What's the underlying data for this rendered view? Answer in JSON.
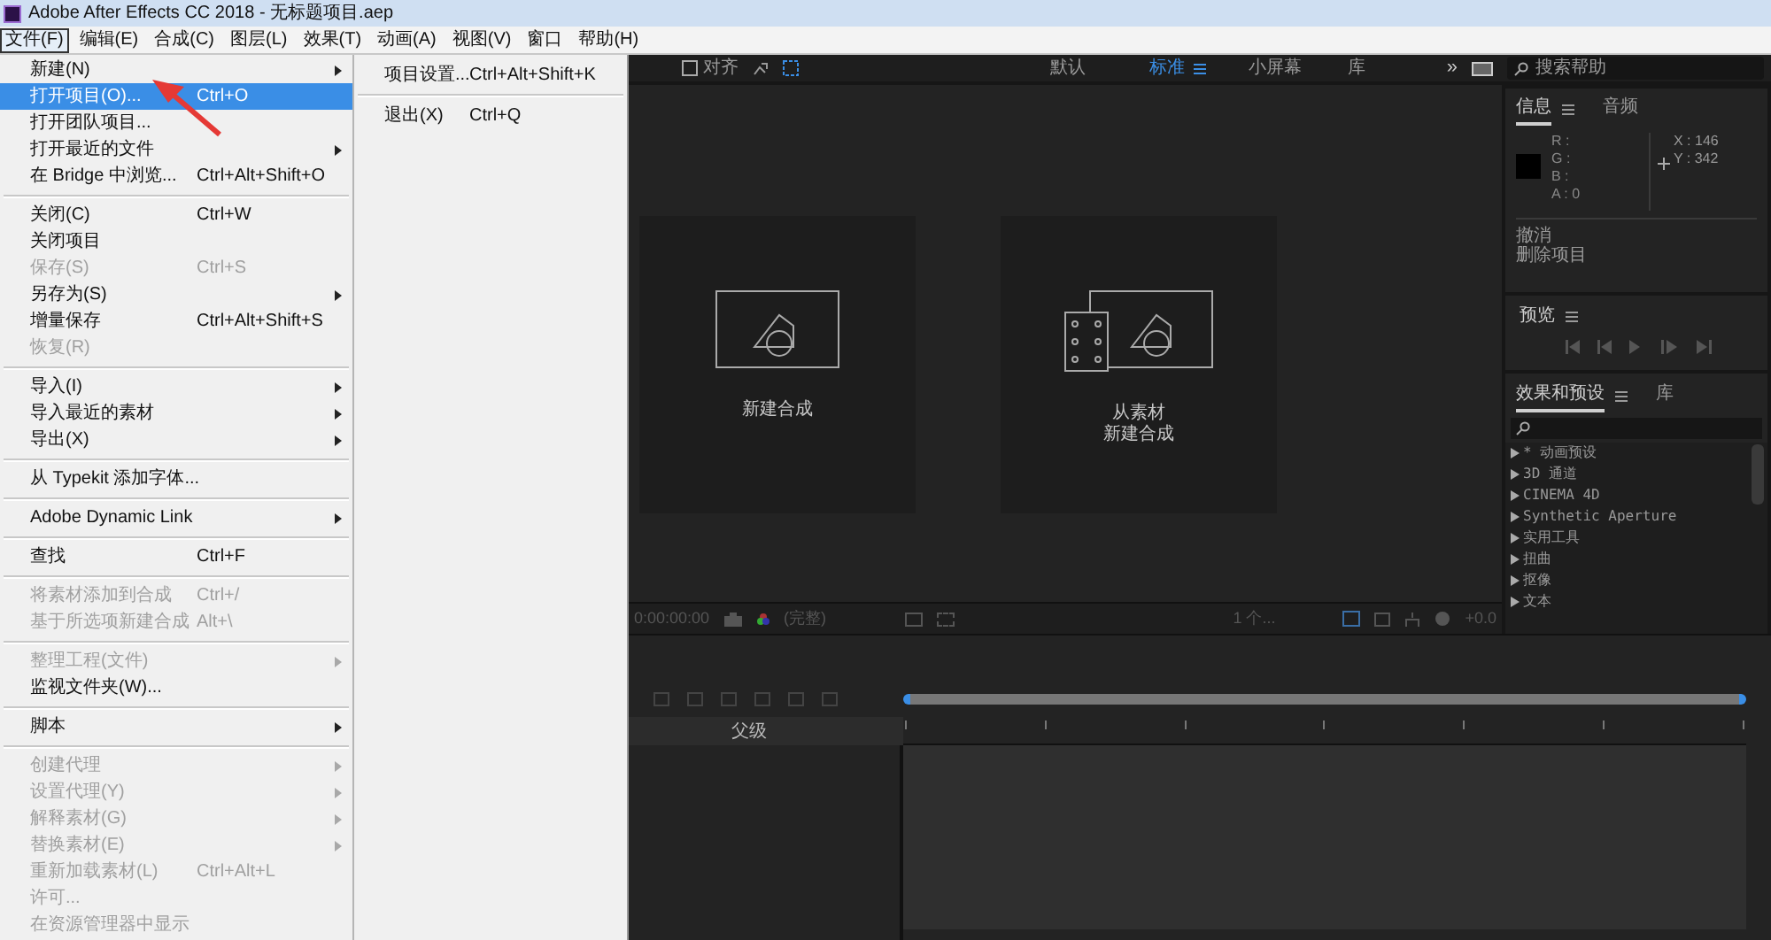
{
  "window": {
    "title": "Adobe After Effects CC 2018 - 无标题项目.aep"
  },
  "menubar": [
    {
      "label": "文件(F)",
      "selected": true
    },
    {
      "label": "编辑(E)",
      "selected": false
    },
    {
      "label": "合成(C)",
      "selected": false
    },
    {
      "label": "图层(L)",
      "selected": false
    },
    {
      "label": "效果(T)",
      "selected": false
    },
    {
      "label": "动画(A)",
      "selected": false
    },
    {
      "label": "视图(V)",
      "selected": false
    },
    {
      "label": "窗口",
      "selected": false
    },
    {
      "label": "帮助(H)",
      "selected": false
    }
  ],
  "file_menu": [
    [
      {
        "label": "新建(N)",
        "submenu": true,
        "disabled": false,
        "selected": false
      },
      {
        "label": "打开项目(O)...",
        "shortcut": "Ctrl+O",
        "disabled": false,
        "selected": true
      },
      {
        "label": "打开团队项目...",
        "disabled": false,
        "selected": false
      },
      {
        "label": "打开最近的文件",
        "submenu": true,
        "disabled": false,
        "selected": false
      },
      {
        "label": "在 Bridge 中浏览...",
        "shortcut": "Ctrl+Alt+Shift+O",
        "disabled": false,
        "selected": false
      }
    ],
    [
      {
        "label": "关闭(C)",
        "shortcut": "Ctrl+W",
        "disabled": false,
        "selected": false
      },
      {
        "label": "关闭项目",
        "disabled": false,
        "selected": false
      },
      {
        "label": "保存(S)",
        "shortcut": "Ctrl+S",
        "disabled": true,
        "selected": false
      },
      {
        "label": "另存为(S)",
        "submenu": true,
        "disabled": false,
        "selected": false
      },
      {
        "label": "增量保存",
        "shortcut": "Ctrl+Alt+Shift+S",
        "disabled": false,
        "selected": false
      },
      {
        "label": "恢复(R)",
        "disabled": true,
        "selected": false
      }
    ],
    [
      {
        "label": "导入(I)",
        "submenu": true,
        "disabled": false,
        "selected": false
      },
      {
        "label": "导入最近的素材",
        "submenu": true,
        "disabled": false,
        "selected": false
      },
      {
        "label": "导出(X)",
        "submenu": true,
        "disabled": false,
        "selected": false
      }
    ],
    [
      {
        "label": "从 Typekit 添加字体...",
        "disabled": false,
        "selected": false
      }
    ],
    [
      {
        "label": "Adobe Dynamic Link",
        "submenu": true,
        "disabled": false,
        "selected": false
      }
    ],
    [
      {
        "label": "查找",
        "shortcut": "Ctrl+F",
        "disabled": false,
        "selected": false
      }
    ],
    [
      {
        "label": "将素材添加到合成",
        "shortcut": "Ctrl+/",
        "disabled": true,
        "selected": false
      },
      {
        "label": "基于所选项新建合成",
        "shortcut": "Alt+\\",
        "disabled": true,
        "selected": false
      }
    ],
    [
      {
        "label": "整理工程(文件)",
        "submenu": true,
        "disabled": true,
        "selected": false
      },
      {
        "label": "监视文件夹(W)...",
        "disabled": false,
        "selected": false
      }
    ],
    [
      {
        "label": "脚本",
        "submenu": true,
        "disabled": false,
        "selected": false
      }
    ],
    [
      {
        "label": "创建代理",
        "submenu": true,
        "disabled": true,
        "selected": false
      },
      {
        "label": "设置代理(Y)",
        "submenu": true,
        "disabled": true,
        "selected": false
      },
      {
        "label": "解释素材(G)",
        "submenu": true,
        "disabled": true,
        "selected": false
      },
      {
        "label": "替换素材(E)",
        "submenu": true,
        "disabled": true,
        "selected": false
      },
      {
        "label": "重新加载素材(L)",
        "shortcut": "Ctrl+Alt+L",
        "disabled": true,
        "selected": false
      },
      {
        "label": "许可...",
        "disabled": true,
        "selected": false
      },
      {
        "label": "在资源管理器中显示",
        "disabled": true,
        "selected": false
      }
    ]
  ],
  "submenu": [
    {
      "label": "项目设置...",
      "shortcut": "Ctrl+Alt+Shift+K"
    },
    {
      "label": "退出(X)",
      "shortcut": "Ctrl+Q"
    }
  ],
  "toolbar": {
    "snap": {
      "label": "对齐",
      "checked": false
    },
    "workspaces": [
      {
        "label": "默认",
        "selected": false
      },
      {
        "label": "标准",
        "selected": true
      },
      {
        "label": "小屏幕",
        "selected": false
      },
      {
        "label": "库",
        "selected": false
      }
    ],
    "overflow": "»",
    "search_placeholder": "搜索帮助"
  },
  "composition": {
    "cards": [
      {
        "kind": "new",
        "lines": [
          "新建合成"
        ]
      },
      {
        "kind": "footage",
        "lines": [
          "从素材",
          "新建合成"
        ]
      }
    ],
    "timecode": "0:00:00:00",
    "resolution": "(完整)",
    "views": "1 个...",
    "exposure": "+0.0"
  },
  "info_panel": {
    "tabs": [
      {
        "label": "信息",
        "selected": true
      },
      {
        "label": "音频",
        "selected": false
      }
    ],
    "channels": [
      "R :",
      "G :",
      "B :",
      "A : 0"
    ],
    "coords": [
      "X : 146",
      "Y : 342"
    ],
    "history": [
      "撤消",
      "删除项目"
    ]
  },
  "preview_panel": {
    "title": "预览"
  },
  "effects_panel": {
    "tabs": [
      {
        "label": "效果和预设",
        "selected": true
      },
      {
        "label": "库",
        "selected": false
      }
    ],
    "items": [
      "* 动画预设",
      "3D 通道",
      "CINEMA 4D",
      "Synthetic Aperture",
      "实用工具",
      "扭曲",
      "抠像",
      "文本"
    ]
  },
  "timeline": {
    "column": "父级"
  }
}
